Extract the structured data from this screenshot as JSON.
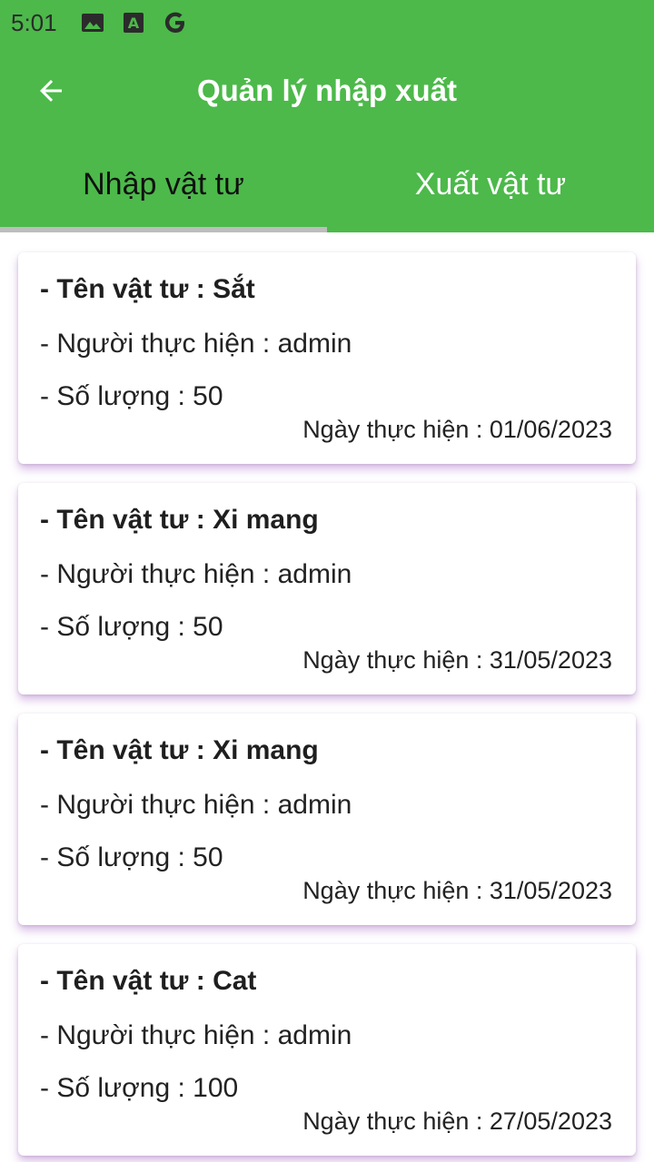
{
  "status_bar": {
    "time": "5:01",
    "icons": [
      "image-icon",
      "font-a-icon",
      "google-g-icon"
    ]
  },
  "app_bar": {
    "title": "Quản lý nhập xuất",
    "back_icon": "arrow-back-icon"
  },
  "colors": {
    "primary": "#4cb94a",
    "card_shadow": "#c79ad9",
    "tab_indicator": "#bdbdbd"
  },
  "tabs": [
    {
      "label": "Nhập vật tư",
      "selected": true
    },
    {
      "label": "Xuất vật tư",
      "selected": false
    }
  ],
  "records": [
    {
      "name": "- Tên vật tư : Sắt",
      "user": "- Người thực hiện : admin",
      "quantity": "- Số lượng : 50",
      "date": "Ngày thực hiện : 01/06/2023"
    },
    {
      "name": "- Tên vật tư : Xi mang",
      "user": "- Người thực hiện : admin",
      "quantity": "- Số lượng : 50",
      "date": "Ngày thực hiện : 31/05/2023"
    },
    {
      "name": "- Tên vật tư : Xi mang",
      "user": "- Người thực hiện : admin",
      "quantity": "- Số lượng : 50",
      "date": "Ngày thực hiện : 31/05/2023"
    },
    {
      "name": "- Tên vật tư : Cat",
      "user": "- Người thực hiện : admin",
      "quantity": "- Số lượng : 100",
      "date": "Ngày thực hiện : 27/05/2023"
    }
  ]
}
